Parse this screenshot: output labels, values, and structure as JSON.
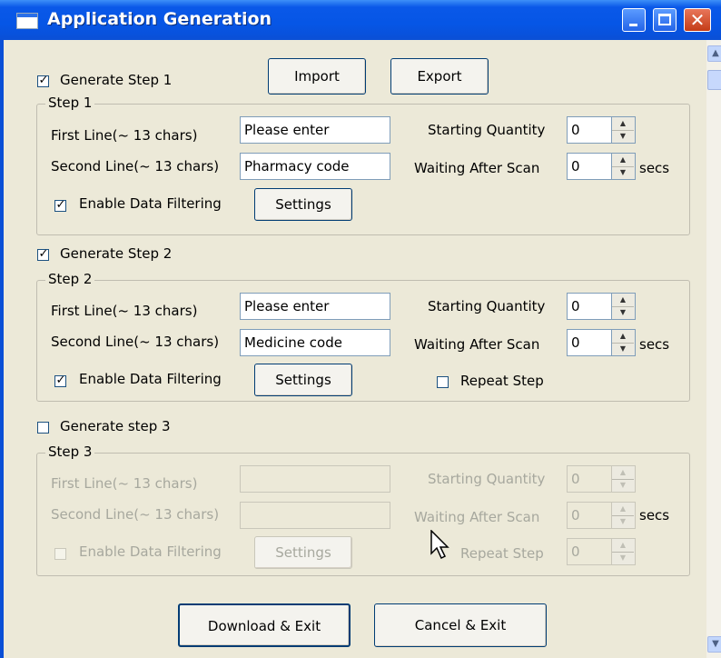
{
  "window": {
    "title": "Application Generation",
    "controls": {
      "minimize": "minimize",
      "maximize": "maximize",
      "close": "close"
    }
  },
  "toolbar": {
    "generate_step1_label": "Generate Step 1",
    "import_label": "Import",
    "export_label": "Export"
  },
  "step1": {
    "legend": "Step 1",
    "first_line_label": "First Line(~ 13 chars)",
    "first_line_value": "Please enter",
    "second_line_label": "Second Line(~ 13 chars)",
    "second_line_value": "Pharmacy code",
    "starting_qty_label": "Starting Quantity",
    "starting_qty_value": "0",
    "waiting_label": "Waiting After Scan",
    "waiting_value": "0",
    "secs_label": "secs",
    "filter_label": "Enable Data Filtering",
    "filter_checked": true,
    "settings_label": "Settings"
  },
  "generate_step2_label": "Generate Step 2",
  "step2": {
    "legend": "Step 2",
    "first_line_label": "First Line(~ 13 chars)",
    "first_line_value": "Please enter",
    "second_line_label": "Second Line(~ 13 chars)",
    "second_line_value": "Medicine code",
    "starting_qty_label": "Starting Quantity",
    "starting_qty_value": "0",
    "waiting_label": "Waiting After Scan",
    "waiting_value": "0",
    "secs_label": "secs",
    "filter_label": "Enable Data Filtering",
    "filter_checked": true,
    "settings_label": "Settings",
    "repeat_label": "Repeat Step",
    "repeat_checked": false
  },
  "generate_step3_label": "Generate step 3",
  "step3": {
    "legend": "Step 3",
    "first_line_label": "First Line(~ 13 chars)",
    "first_line_value": "",
    "second_line_label": "Second Line(~ 13 chars)",
    "second_line_value": "",
    "starting_qty_label": "Starting Quantity",
    "starting_qty_value": "0",
    "waiting_label": "Waiting After Scan",
    "waiting_value": "0",
    "secs_label": "secs",
    "filter_label": "Enable Data Filtering",
    "settings_label": "Settings",
    "repeat_label": "Repeat Step",
    "repeat_value": "0"
  },
  "footer": {
    "download_label": "Download & Exit",
    "cancel_label": "Cancel & Exit"
  },
  "colors": {
    "titlebar": "#0a4fd6",
    "dialog_bg": "#ece9d8",
    "disabled_text": "#a7a89e"
  }
}
